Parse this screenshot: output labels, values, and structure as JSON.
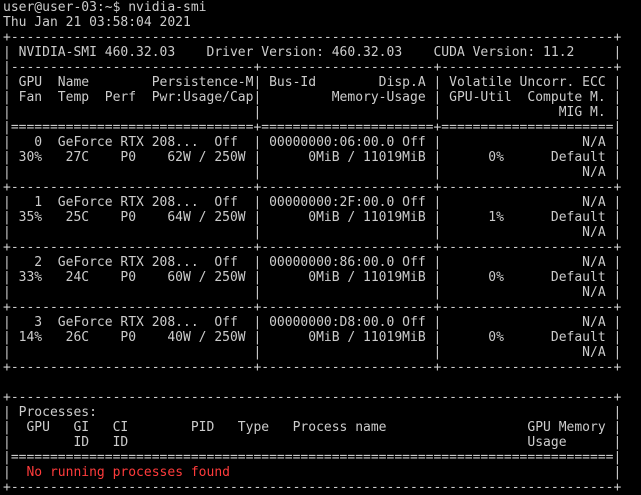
{
  "terminal": {
    "colors": {
      "background": "#000000",
      "foreground": "#cccccc",
      "error": "#ff3b3b"
    },
    "lines": [
      {
        "text": "user@user-03:~$ nvidia-smi"
      },
      {
        "text": "Thu Jan 21 03:58:04 2021"
      },
      {
        "text": "+-----------------------------------------------------------------------------+"
      },
      {
        "text": "| NVIDIA-SMI 460.32.03    Driver Version: 460.32.03    CUDA Version: 11.2     |"
      },
      {
        "text": "|-------------------------------+----------------------+----------------------+"
      },
      {
        "text": "| GPU  Name        Persistence-M| Bus-Id        Disp.A | Volatile Uncorr. ECC |"
      },
      {
        "text": "| Fan  Temp  Perf  Pwr:Usage/Cap|         Memory-Usage | GPU-Util  Compute M. |"
      },
      {
        "text": "|                               |                      |               MIG M. |"
      },
      {
        "text": "|===============================+======================+======================|"
      },
      {
        "text": "|   0  GeForce RTX 208...  Off  | 00000000:06:00.0 Off |                  N/A |"
      },
      {
        "text": "| 30%   27C    P0    62W / 250W |      0MiB / 11019MiB |      0%      Default |"
      },
      {
        "text": "|                               |                      |                  N/A |"
      },
      {
        "text": "+-------------------------------+----------------------+----------------------+"
      },
      {
        "text": "|   1  GeForce RTX 208...  Off  | 00000000:2F:00.0 Off |                  N/A |"
      },
      {
        "text": "| 35%   25C    P0    64W / 250W |      0MiB / 11019MiB |      1%      Default |"
      },
      {
        "text": "|                               |                      |                  N/A |"
      },
      {
        "text": "+-------------------------------+----------------------+----------------------+"
      },
      {
        "text": "|   2  GeForce RTX 208...  Off  | 00000000:86:00.0 Off |                  N/A |"
      },
      {
        "text": "| 33%   24C    P0    60W / 250W |      0MiB / 11019MiB |      0%      Default |"
      },
      {
        "text": "|                               |                      |                  N/A |"
      },
      {
        "text": "+-------------------------------+----------------------+----------------------+"
      },
      {
        "text": "|   3  GeForce RTX 208...  Off  | 00000000:D8:00.0 Off |                  N/A |"
      },
      {
        "text": "| 14%   26C    P0    40W / 250W |      0MiB / 11019MiB |      0%      Default |"
      },
      {
        "text": "|                               |                      |                  N/A |"
      },
      {
        "text": "+-------------------------------+----------------------+----------------------+"
      },
      {
        "text": ""
      },
      {
        "text": "+-----------------------------------------------------------------------------+"
      },
      {
        "text": "| Processes:                                                                  |"
      },
      {
        "text": "|  GPU   GI   CI        PID   Type   Process name                  GPU Memory |"
      },
      {
        "text": "|        ID   ID                                                   Usage      |"
      },
      {
        "text": "|=============================================================================|"
      },
      {
        "text": "|  No running processes found                                                 |"
      },
      {
        "text": "+-----------------------------------------------------------------------------+"
      }
    ]
  }
}
